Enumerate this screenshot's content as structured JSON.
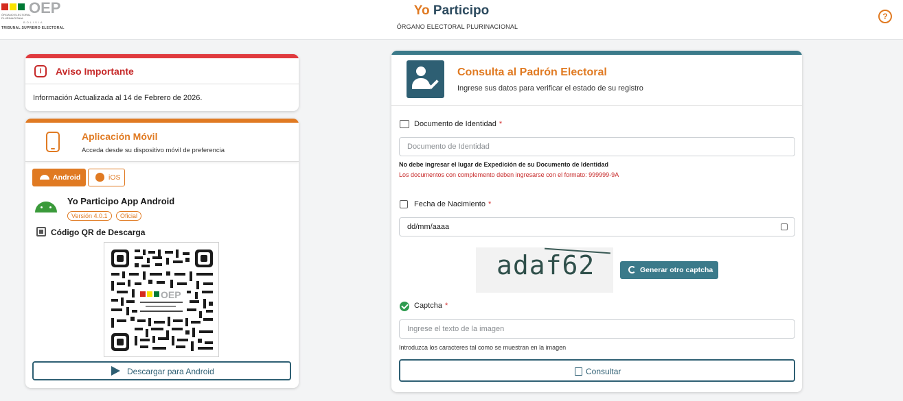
{
  "header": {
    "logo_text": "OEP",
    "logo_small": "ÓRGANO ELECTORAL PLURINACIONAL",
    "logo_country": "BOLIVIA",
    "logo_sub": "TRIBUNAL SUPREMO ELECTORAL",
    "title_first": "Yo",
    "title_second": "Participo",
    "subtitle": "ÓRGANO ELECTORAL PLURINACIONAL",
    "help_symbol": "?",
    "flag_colors": [
      "#d52b1e",
      "#f9e300",
      "#007934"
    ]
  },
  "aviso": {
    "icon_symbol": "i",
    "title": "Aviso Importante",
    "text": "Información Actualizada al 14 de Febrero de 2026."
  },
  "movil": {
    "title": "Aplicación Móvil",
    "subtitle": "Acceda desde su dispositivo móvil de preferencia",
    "tabs": [
      {
        "label": "Android",
        "active": true
      },
      {
        "label": "iOS",
        "active": false
      }
    ],
    "app_name": "Yo Participo App Android",
    "version": "Versión 4.0.1",
    "official": "Oficial",
    "qr_label": "Código QR de Descarga",
    "download_button": "Descargar para Android"
  },
  "consulta": {
    "title": "Consulta al Padrón Electoral",
    "subtitle": "Ingrese sus datos para verificar el estado de su registro",
    "doc_label": "Documento de Identidad",
    "doc_placeholder": "Documento de Identidad",
    "doc_note": "No debe ingresar el lugar de Expedición de su Documento de Identidad",
    "doc_note_red": "Los documentos con complemento deben ingresarse con el formato: 999999-9A",
    "birth_label": "Fecha de Nacimiento",
    "birth_placeholder": "dd/mm/aaaa",
    "captcha_image_text": "adaf62",
    "captcha_button": "Generar otro captcha",
    "captcha_label": "Captcha",
    "captcha_placeholder": "Ingrese el texto de la imagen",
    "captcha_help": "Introduzca los caracteres tal como se muestran en la imagen",
    "submit_button": "Consultar",
    "required_mark": "*"
  },
  "colors": {
    "accent": "#e07a22",
    "primary": "#2e5f73",
    "danger": "#c62828",
    "teal": "#3b7a8a",
    "success": "#2e9b4f"
  }
}
